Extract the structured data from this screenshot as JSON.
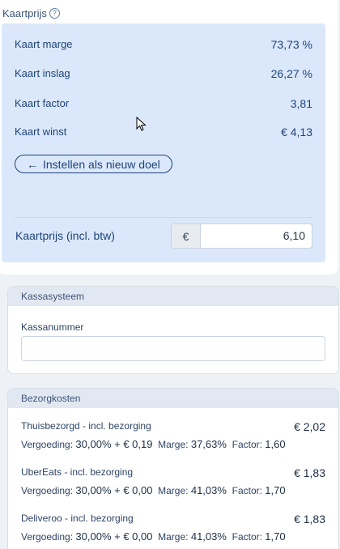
{
  "kaartprijs": {
    "title": "Kaartprijs",
    "help_icon": "?",
    "rows": [
      {
        "label": "Kaart marge",
        "value": "73,73 %"
      },
      {
        "label": "Kaart inslag",
        "value": "26,27 %"
      },
      {
        "label": "Kaart factor",
        "value": "3,81"
      },
      {
        "label": "Kaart winst",
        "value": "€ 4,13"
      }
    ],
    "set_goal_button": "Instellen als nieuw doel",
    "arrow_icon": "←",
    "price_label": "Kaartprijs (incl. btw)",
    "currency": "€",
    "price_value": "6,10"
  },
  "kassasysteem": {
    "header": "Kassasysteem",
    "field_label": "Kassanummer",
    "field_value": ""
  },
  "bezorgkosten": {
    "header": "Bezorgkosten",
    "items": [
      {
        "name": "Thuisbezorgd - incl. bezorging",
        "price": "€ 2,02",
        "vergoeding_label": "Vergoeding:",
        "vergoeding": "30,00% + € 0,19",
        "marge_label": "Marge:",
        "marge": "37,63%",
        "factor_label": "Factor:",
        "factor": "1,60"
      },
      {
        "name": "UberEats - incl. bezorging",
        "price": "€ 1,83",
        "vergoeding_label": "Vergoeding:",
        "vergoeding": "30,00% + € 0,00",
        "marge_label": "Marge:",
        "marge": "41,03%",
        "factor_label": "Factor:",
        "factor": "1,70"
      },
      {
        "name": "Deliveroo - incl. bezorging",
        "price": "€ 1,83",
        "vergoeding_label": "Vergoeding:",
        "vergoeding": "30,00% + € 0,00",
        "marge_label": "Marge:",
        "marge": "41,03%",
        "factor_label": "Factor:",
        "factor": "1,70"
      }
    ]
  },
  "colors": {
    "panel_blue": "#dbe8fb",
    "text_blue": "#1e4377",
    "header_grey": "#e2e8f1"
  }
}
